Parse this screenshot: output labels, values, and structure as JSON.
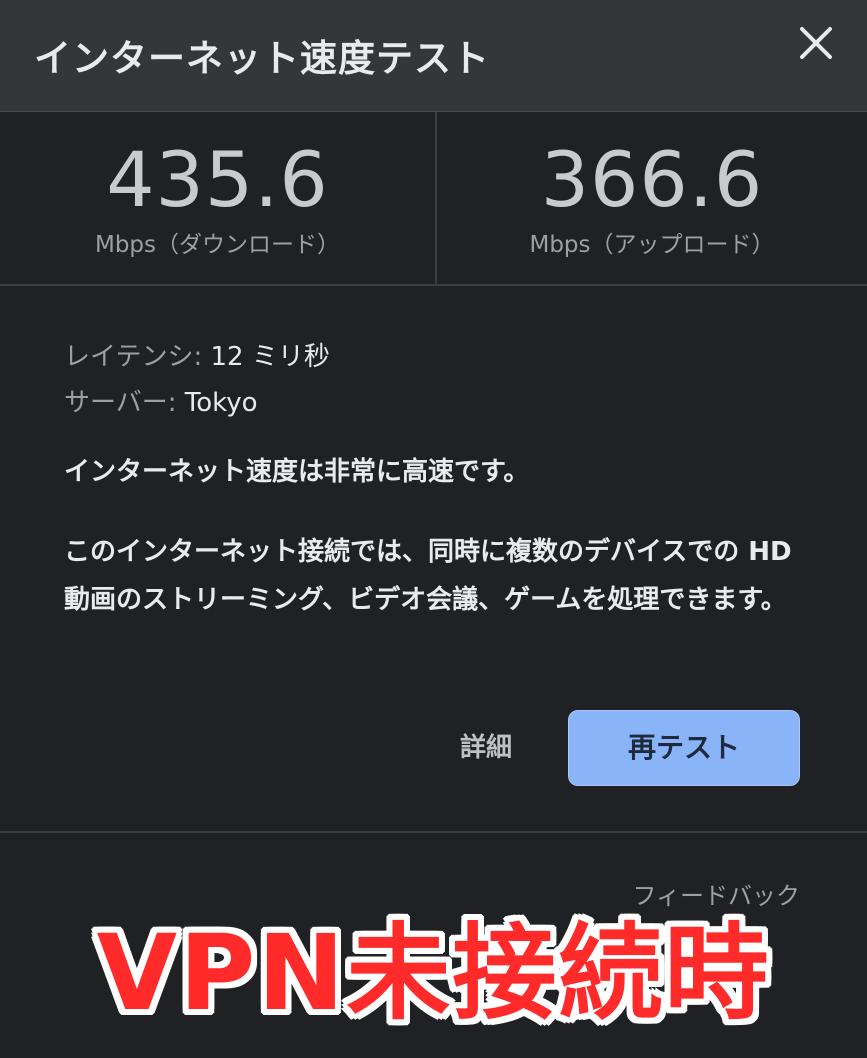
{
  "header": {
    "title": "インターネット速度テスト",
    "close_icon": "close-icon"
  },
  "results": {
    "download": {
      "value": "435.6",
      "unit": "Mbps（ダウンロード）"
    },
    "upload": {
      "value": "366.6",
      "unit": "Mbps（アップロード）"
    }
  },
  "info": {
    "latency_label": "レイテンシ:",
    "latency_value": "12 ミリ秒",
    "server_label": "サーバー:",
    "server_value": "Tokyo"
  },
  "verdict": "インターネット速度は非常に高速です。",
  "description": "このインターネット接続では、同時に複数のデバイスでの HD 動画のストリーミング、ビデオ会議、ゲームを処理できます。",
  "buttons": {
    "details": "詳細",
    "retest": "再テスト"
  },
  "footer": {
    "feedback": "フィードバック"
  },
  "overlay_caption": "VPN未接続時",
  "colors": {
    "header_bg": "#35363a",
    "body_bg": "#202124",
    "retest_bg": "#8ab4f8",
    "caption_red": "#ff2a2a"
  }
}
